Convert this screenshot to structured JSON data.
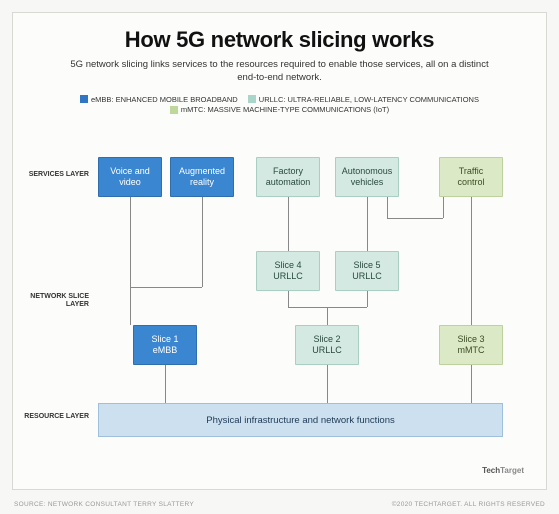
{
  "header": {
    "title": "How 5G network slicing works",
    "subtitle": "5G network slicing links services to the resources required to enable those services, all on a distinct end-to-end network."
  },
  "legend": {
    "embb": {
      "label": "eMBB: ENHANCED MOBILE BROADBAND",
      "color": "#2f77c5"
    },
    "urllc": {
      "label": "URLLC: ULTRA-RELIABLE, LOW-LATENCY COMMUNICATIONS",
      "color": "#a9d6c8"
    },
    "mmtc": {
      "label": "mMTC: MASSIVE MACHINE-TYPE COMMUNICATIONS (IoT)",
      "color": "#bdd89a"
    }
  },
  "layers": {
    "services": "SERVICES LAYER",
    "slice": "NETWORK SLICE LAYER",
    "resource": "RESOURCE LAYER"
  },
  "services": {
    "voice_video": "Voice and video",
    "augmented": "Augmented reality",
    "factory": "Factory automation",
    "vehicles": "Autonomous vehicles",
    "traffic": "Traffic control"
  },
  "slices": {
    "s4": {
      "name": "Slice 4",
      "type": "URLLC"
    },
    "s5": {
      "name": "Slice 5",
      "type": "URLLC"
    },
    "s1": {
      "name": "Slice 1",
      "type": "eMBB"
    },
    "s2": {
      "name": "Slice 2",
      "type": "URLLC"
    },
    "s3": {
      "name": "Slice 3",
      "type": "mMTC"
    }
  },
  "resource": {
    "label": "Physical infrastructure and network functions"
  },
  "footer": {
    "left": "SOURCE: NETWORK CONSULTANT TERRY SLATTERY",
    "right": "©2020 TECHTARGET. ALL RIGHTS RESERVED",
    "logo_prefix": "Tech",
    "logo_suffix": "Target"
  }
}
